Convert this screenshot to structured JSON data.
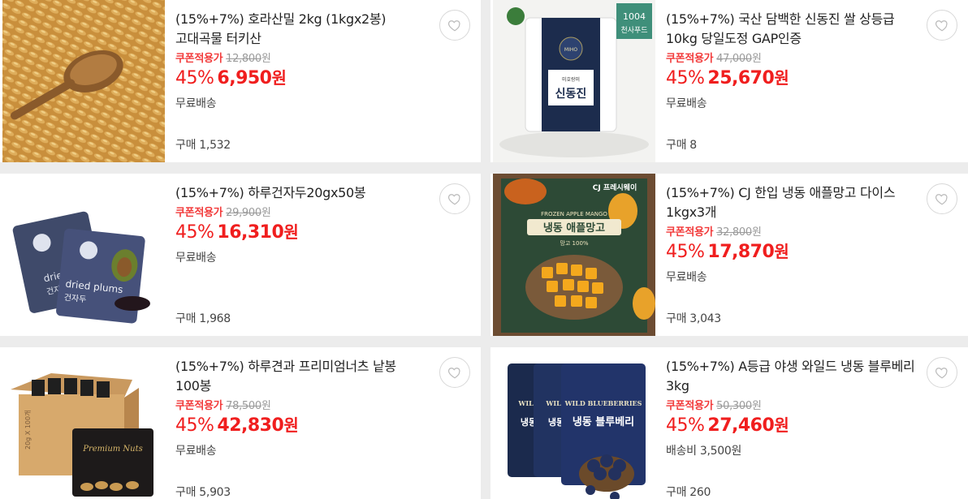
{
  "products": [
    {
      "title": "(15%+7%) 호라산밀 2kg (1kgx2봉) 고대곡물 터키산",
      "coupon_label": "쿠폰적용가",
      "original_price": "12,800",
      "original_won": "원",
      "discount": "45%",
      "price": "6,950",
      "won": "원",
      "shipping": "무료배송",
      "purchase": "구매 1,532",
      "image_icon": "wheat-grain-image"
    },
    {
      "title": "(15%+7%) 국산 담백한 신동진 쌀 상등급 10kg 당일도정 GAP인증",
      "coupon_label": "쿠폰적용가",
      "original_price": "47,000",
      "original_won": "원",
      "discount": "45%",
      "price": "25,670",
      "won": "원",
      "shipping": "무료배송",
      "purchase": "구매 8",
      "image_icon": "rice-bag-image",
      "image_text": {
        "brand_badge": "천사푸드",
        "brand_num": "1004",
        "bag_label": "신동진",
        "bag_top": "미호랑미",
        "seal_text": "MIHO"
      }
    },
    {
      "title": "(15%+7%) 하루건자두20gx50봉",
      "coupon_label": "쿠폰적용가",
      "original_price": "29,900",
      "original_won": "원",
      "discount": "45%",
      "price": "16,310",
      "won": "원",
      "shipping": "무료배송",
      "purchase": "구매 1,968",
      "image_icon": "dried-plums-image",
      "image_text": {
        "pack_label": "dried plums",
        "pack_label_ko": "건자두",
        "back_label": "dried",
        "back_ko": "건자두"
      }
    },
    {
      "title": "(15%+7%) CJ 한입 냉동 애플망고 다이스 1kgx3개",
      "coupon_label": "쿠폰적용가",
      "original_price": "32,800",
      "original_won": "원",
      "discount": "45%",
      "price": "17,870",
      "won": "원",
      "shipping": "무료배송",
      "purchase": "구매 3,043",
      "image_icon": "mango-box-image",
      "image_text": {
        "brand": "CJ 프레시웨이",
        "en": "FROZEN APPLE MANGO",
        "ko": "냉동 애플망고",
        "sub": "망고 100%"
      }
    },
    {
      "title": "(15%+7%) 하루견과 프리미엄너츠 낱봉 100봉",
      "coupon_label": "쿠폰적용가",
      "original_price": "78,500",
      "original_won": "원",
      "discount": "45%",
      "price": "42,830",
      "won": "원",
      "shipping": "무료배송",
      "purchase": "구매 5,903",
      "image_icon": "nuts-box-image",
      "image_text": {
        "pack": "Premium Nuts",
        "box": "20g X 100개"
      }
    },
    {
      "title": "(15%+7%) A등급 야생 와일드 냉동 블루베리 3kg",
      "coupon_label": "쿠폰적용가",
      "original_price": "50,300",
      "original_won": "원",
      "discount": "45%",
      "price": "27,460",
      "won": "원",
      "shipping": "배송비 3,500원",
      "purchase": "구매 260",
      "image_icon": "blueberry-bags-image",
      "image_text": {
        "en": "WILD BLUEBERRIES",
        "ko": "냉동 블루베리",
        "front_short": "WILD",
        "ko_short": "냉동"
      }
    }
  ]
}
